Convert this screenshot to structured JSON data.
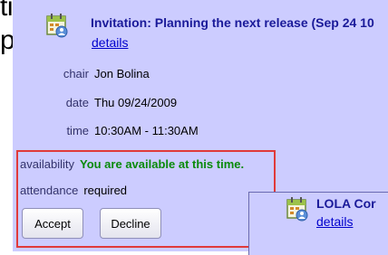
{
  "background": {
    "line1": "tions",
    "line2": "picker"
  },
  "event": {
    "title": "Invitation: Planning the next release (Sep 24 10",
    "details_link": "details",
    "chair_label": "chair",
    "chair_value": "Jon Bolina",
    "date_label": "date",
    "date_value": "Thu 09/24/2009",
    "time_label": "time",
    "time_value": "10:30AM - 11:30AM",
    "availability_label": "availability",
    "availability_value": "You are available at this time.",
    "attendance_label": "attendance",
    "attendance_value": "required",
    "accept_label": "Accept",
    "decline_label": "Decline"
  },
  "second_event": {
    "title": "LOLA Cor",
    "details_link": "details"
  },
  "colors": {
    "panel_bg": "#ccccff",
    "highlight_border": "#e03a3a",
    "available_text": "#0a8a0a",
    "link": "#0000cc"
  },
  "icons": {
    "event_icon": "calendar-icon"
  }
}
